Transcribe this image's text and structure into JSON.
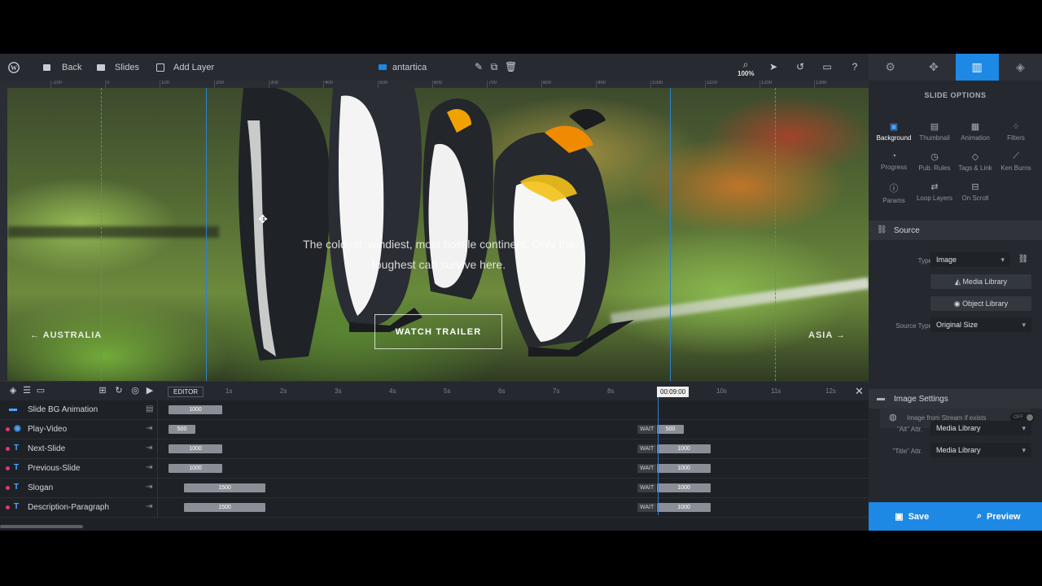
{
  "toolbar": {
    "back": "Back",
    "slides": "Slides",
    "add_layer": "Add Layer",
    "slide_name": "antartica",
    "zoom": "100%"
  },
  "ruler": [
    "-100",
    "0",
    "100",
    "200",
    "300",
    "400",
    "500",
    "600",
    "700",
    "800",
    "900",
    "1000",
    "1100",
    "1200",
    "1300"
  ],
  "canvas": {
    "slogan": "The coldest, windiest, most hostile continent. Only the toughest can survive here.",
    "button": "WATCH TRAILER",
    "nav_left": "← AUSTRALIA",
    "nav_right": "ASIA →"
  },
  "timeline": {
    "editor_label": "EDITOR",
    "seconds": [
      "1s",
      "2s",
      "3s",
      "4s",
      "5s",
      "6s",
      "7s",
      "8s",
      "9s",
      "10s",
      "11s",
      "12s"
    ],
    "current_time": "00:09:00",
    "rows": [
      {
        "label": "Slide BG Animation",
        "type": "bg",
        "bar": "1000",
        "wait": "",
        "end": ""
      },
      {
        "label": "Play-Video",
        "type": "video",
        "bar": "500",
        "wait": "WAIT",
        "end": "500"
      },
      {
        "label": "Next-Slide",
        "type": "T",
        "bar": "1000",
        "wait": "WAIT",
        "end": "1000"
      },
      {
        "label": "Previous-Slide",
        "type": "T",
        "bar": "1000",
        "wait": "WAIT",
        "end": "1000"
      },
      {
        "label": "Slogan",
        "type": "T",
        "bar": "1500",
        "wait": "WAIT",
        "end": "1000"
      },
      {
        "label": "Description-Paragraph",
        "type": "T",
        "bar": "1500",
        "wait": "WAIT",
        "end": "1000"
      }
    ]
  },
  "panel": {
    "title": "SLIDE OPTIONS",
    "options": [
      "Background",
      "Thumbnail",
      "Animation",
      "Filters",
      "Progress",
      "Pub. Rules",
      "Tags & Link",
      "Ken Burns",
      "Params",
      "Loop Layers",
      "On Scroll"
    ],
    "active_option": "Background",
    "source_section": "Source",
    "type_label": "Type",
    "type_value": "Image",
    "media_library": "Media Library",
    "object_library": "Object Library",
    "source_type_label": "Source Type",
    "source_type_value": "Original Size",
    "stream_label": "Image from Stream if exists",
    "stream_toggle": "OFF",
    "image_settings": "Image Settings",
    "alt_label": "\"Alt\" Attr.",
    "alt_value": "Media Library",
    "title_label": "\"Title\" Attr.",
    "title_value": "Media Library"
  },
  "actions": {
    "save": "Save",
    "preview": "Preview"
  },
  "colors": {
    "accent": "#1e88e5",
    "layer_dot": "#e0357f"
  }
}
